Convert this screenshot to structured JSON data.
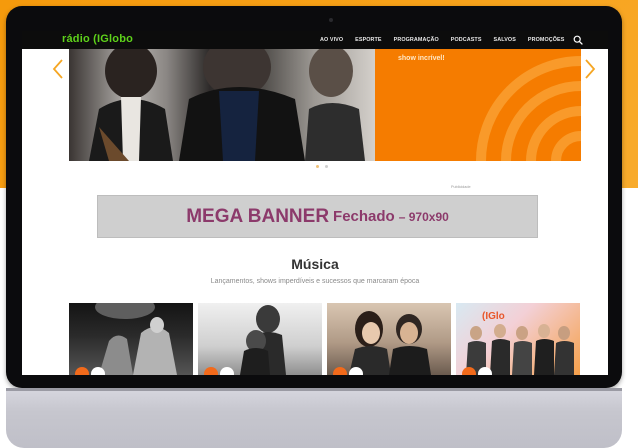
{
  "brand": {
    "logo_text": "rádio (IGlobo",
    "logo_color": "#5ed21a",
    "accent_orange": "#f57c00"
  },
  "nav": {
    "items": [
      "AO VIVO",
      "ESPORTE",
      "PROGRAMAÇÃO",
      "PODCASTS",
      "SALVOS",
      "PROMOÇÕES"
    ],
    "search_icon": "search-icon"
  },
  "hero": {
    "caption": "show incrível!",
    "prev_icon": "chevron-left-icon",
    "next_icon": "chevron-right-icon",
    "dots": 2,
    "active_dot": 0
  },
  "ad": {
    "label": "Publicidade",
    "banner_main": "MEGA BANNER",
    "banner_sub": "Fechado",
    "banner_size": "– 970x90",
    "banner_color": "#8c3a6b"
  },
  "music": {
    "title": "Música",
    "subtitle": "Lançamentos, shows imperdíveis e sucessos que marcaram época",
    "cards": [
      {
        "name": "card-concert-stage"
      },
      {
        "name": "card-duo-portrait"
      },
      {
        "name": "card-couple-portrait"
      },
      {
        "name": "card-band-studio"
      }
    ]
  }
}
